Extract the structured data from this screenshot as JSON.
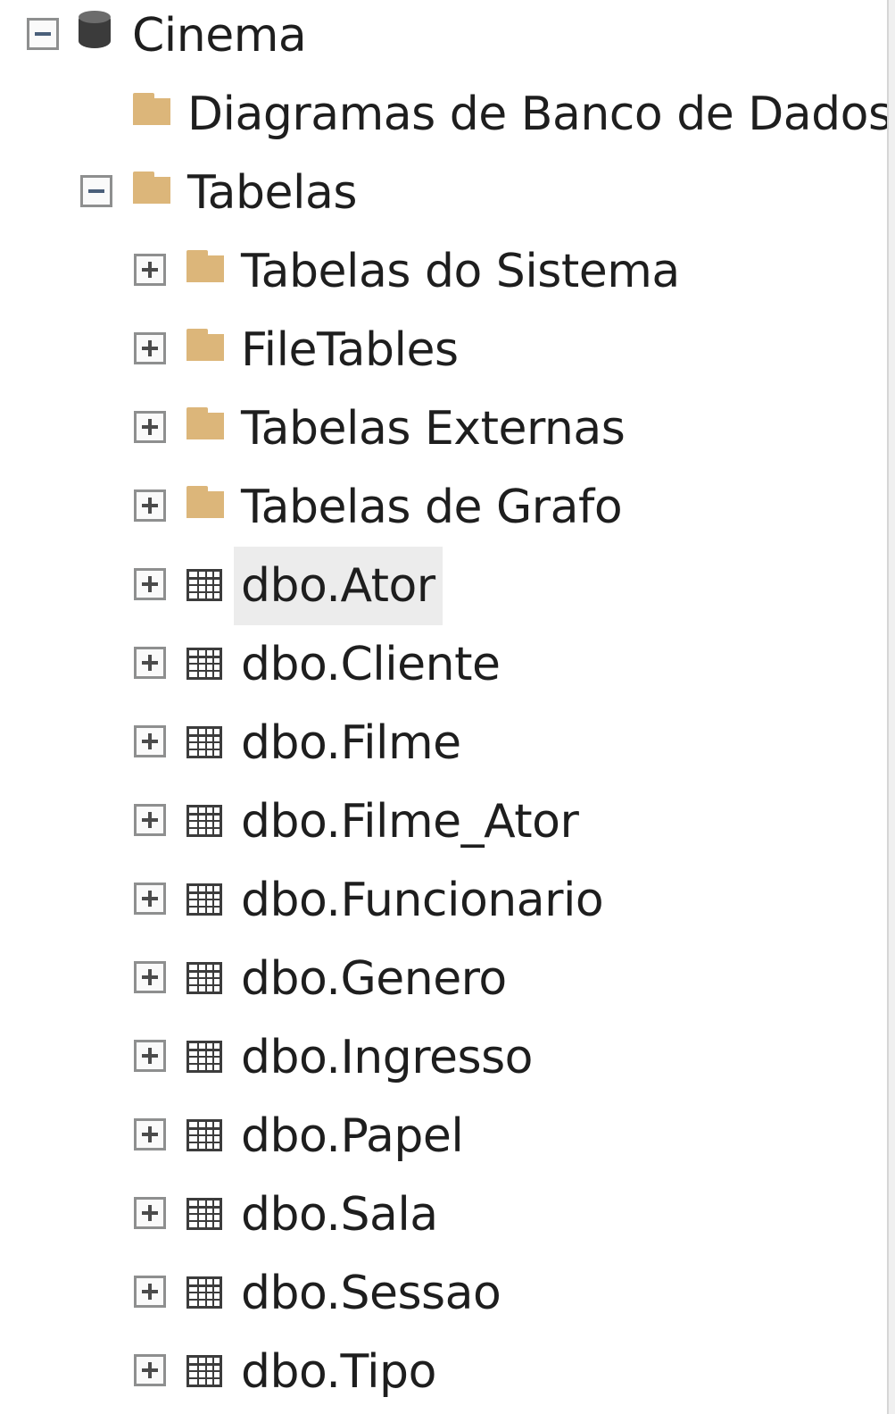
{
  "tree": {
    "database": {
      "label": "Cinema",
      "icon": "database-icon",
      "expanded": true
    },
    "diagrams": {
      "label": "Diagramas de Banco de Dados",
      "icon": "folder-icon"
    },
    "tables_folder": {
      "label": "Tabelas",
      "icon": "folder-icon",
      "expanded": true
    },
    "subfolders": [
      {
        "label": "Tabelas do Sistema",
        "icon": "folder-icon"
      },
      {
        "label": "FileTables",
        "icon": "folder-icon"
      },
      {
        "label": "Tabelas Externas",
        "icon": "folder-icon"
      },
      {
        "label": "Tabelas de Grafo",
        "icon": "folder-icon"
      }
    ],
    "tables": [
      {
        "label": "dbo.Ator",
        "icon": "table-icon",
        "selected": true
      },
      {
        "label": "dbo.Cliente",
        "icon": "table-icon"
      },
      {
        "label": "dbo.Filme",
        "icon": "table-icon"
      },
      {
        "label": "dbo.Filme_Ator",
        "icon": "table-icon"
      },
      {
        "label": "dbo.Funcionario",
        "icon": "table-icon"
      },
      {
        "label": "dbo.Genero",
        "icon": "table-icon"
      },
      {
        "label": "dbo.Ingresso",
        "icon": "table-icon"
      },
      {
        "label": "dbo.Papel",
        "icon": "table-icon"
      },
      {
        "label": "dbo.Sala",
        "icon": "table-icon"
      },
      {
        "label": "dbo.Sessao",
        "icon": "table-icon"
      },
      {
        "label": "dbo.Tipo",
        "icon": "table-icon"
      }
    ]
  },
  "colors": {
    "folder": "#dcb67a",
    "selection": "#ececec",
    "text": "#1e1e1e"
  }
}
